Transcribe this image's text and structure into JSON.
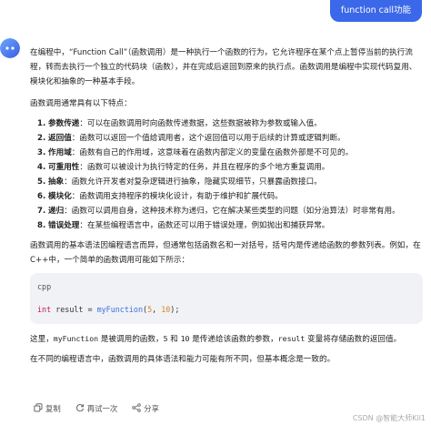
{
  "user_message": "function call功能",
  "intro": "在编程中，“Function Call”（函数调用）是一种执行一个函数的行为，它允许程序在某个点上暂停当前的执行流程，转而去执行一个独立的代码块（函数），并在完成后返回到原来的执行点。函数调用是编程中实现代码复用、模块化和抽象的一种基本手段。",
  "list_lead": "函数调用通常具有以下特点：",
  "features": [
    {
      "num": "1.",
      "term": "参数传递",
      "text": "：可以在函数调用时向函数传递数据，这些数据被称为参数或输入值。"
    },
    {
      "num": "2.",
      "term": "返回值",
      "text": "：函数可以返回一个值给调用者，这个返回值可以用于后续的计算或逻辑判断。"
    },
    {
      "num": "3.",
      "term": "作用域",
      "text": "：函数有自己的作用域，这意味着在函数内部定义的变量在函数外部是不可见的。"
    },
    {
      "num": "4.",
      "term": "可重用性",
      "text": "：函数可以被设计为执行特定的任务，并且在程序的多个地方重复调用。"
    },
    {
      "num": "5.",
      "term": "抽象",
      "text": "：函数允许开发者对复杂逻辑进行抽象，隐藏实现细节，只暴露函数接口。"
    },
    {
      "num": "6.",
      "term": "模块化",
      "text": "：函数调用支持程序的模块化设计，有助于维护和扩展代码。"
    },
    {
      "num": "7.",
      "term": "递归",
      "text": "：函数可以调用自身，这种技术称为递归，它在解决某些类型的问题（如分治算法）时非常有用。"
    },
    {
      "num": "8.",
      "term": "错误处理",
      "text": "：在某些编程语言中，函数还可以用于错误处理，例如抛出和捕获异常。"
    }
  ],
  "syntax_para": "函数调用的基本语法因编程语言而异，但通常包括函数名和一对括号，括号内是传递给函数的参数列表。例如，在C++中，一个简单的函数调用可能如下所示：",
  "code": {
    "lang": "cpp",
    "type": "int",
    "var": "result",
    "eq": "=",
    "fn": "myFunction",
    "arg1": "5",
    "arg2": "10"
  },
  "explain": {
    "p1": "这里，",
    "fn": "myFunction",
    "p2": "是被调用的函数，",
    "a1": "5",
    "p3": "和",
    "a2": "10",
    "p4": "是传递给该函数的参数，",
    "var": "result",
    "p5": "变量将存储函数的返回值。"
  },
  "closing": "在不同的编程语言中，函数调用的具体语法和能力可能有所不同，但基本概念是一致的。",
  "actions": {
    "copy": "复制",
    "regenerate": "再试一次",
    "share": "分享"
  },
  "watermark": "CSDN @智能大师Kil1",
  "colors": {
    "accent": "#3b68e8",
    "keyword": "#c2185b",
    "function": "#3d6fdc",
    "number": "#d9822b"
  }
}
